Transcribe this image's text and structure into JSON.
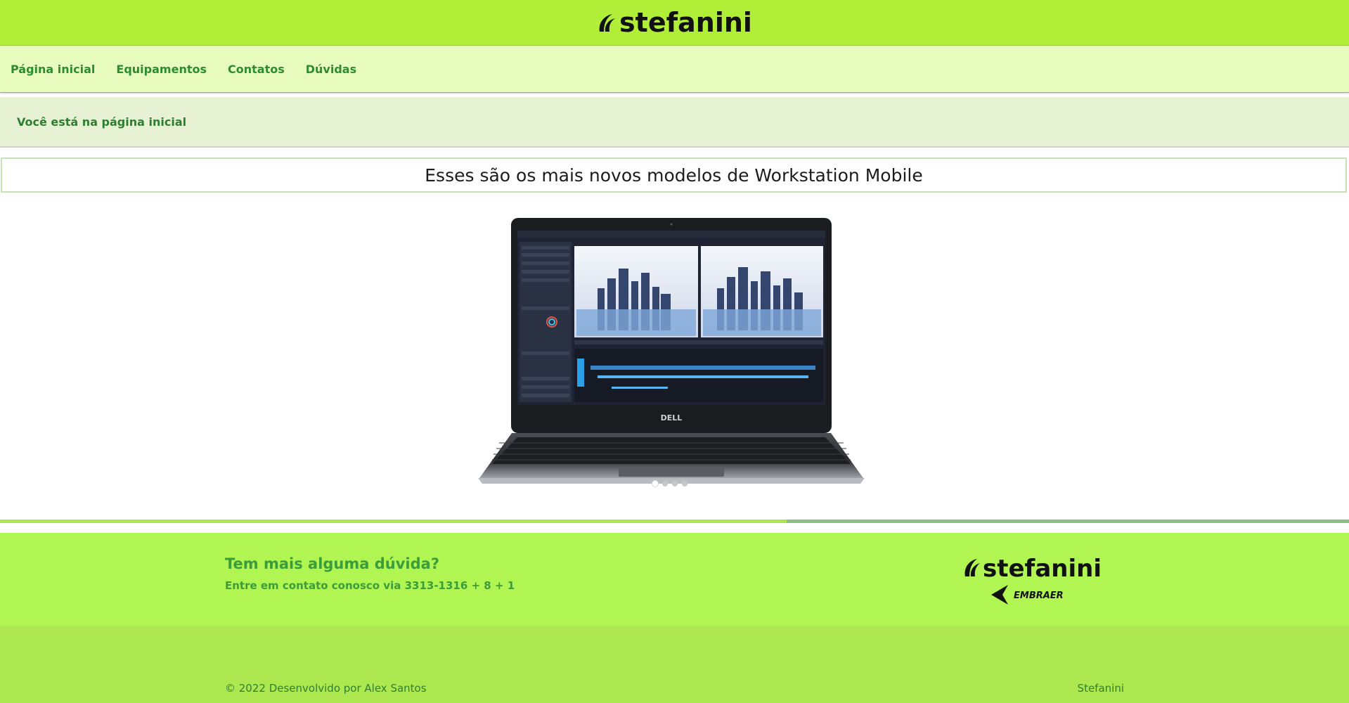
{
  "header": {
    "brand": "stefanini"
  },
  "nav": {
    "items": [
      {
        "label": "Página inicial"
      },
      {
        "label": "Equipamentos"
      },
      {
        "label": "Contatos"
      },
      {
        "label": "Dúvidas"
      }
    ]
  },
  "breadcrumb": {
    "text": "Você está na página inicial"
  },
  "main": {
    "headline": "Esses são os mais novos modelos de Workstation Mobile",
    "carousel": {
      "slide_count": 4,
      "active_index": 0,
      "laptop_brand": "DELL",
      "progress": 0.583
    }
  },
  "footer": {
    "title": "Tem mais alguma dúvida?",
    "subtitle": "Entre em contato conosco via 3313-1316 + 8 + 1",
    "logo_brand": "stefanini",
    "logo_partner": "EMBRAER"
  },
  "bottom": {
    "copyright": "© 2022 Desenvolvido por Alex Santos",
    "brand_link": "Stefanini"
  },
  "colors": {
    "header_green": "#b0ee37",
    "nav_bg": "#e6fbbd",
    "text_green": "#2e8b2e",
    "footer_green": "#b1f553"
  }
}
